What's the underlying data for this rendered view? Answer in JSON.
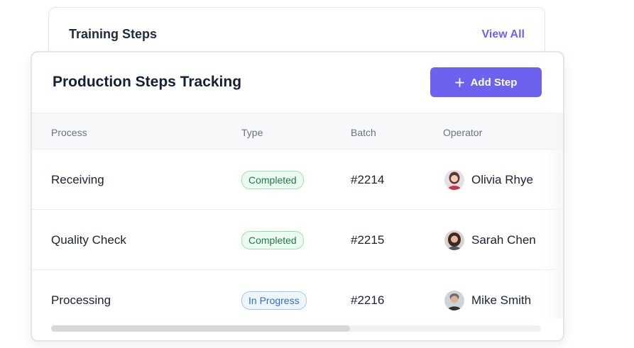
{
  "training": {
    "title": "Training Steps",
    "view_all": "View All"
  },
  "production": {
    "title": "Production Steps Tracking",
    "add_button": "Add Step",
    "columns": [
      "Process",
      "Type",
      "Batch",
      "Operator"
    ],
    "rows": [
      {
        "process": "Receiving",
        "type": "Completed",
        "batch": "#2214",
        "operator": "Olivia Rhye"
      },
      {
        "process": "Quality Check",
        "type": "Completed",
        "batch": "#2215",
        "operator": "Sarah Chen"
      },
      {
        "process": "Processing",
        "type": "In Progress",
        "batch": "#2216",
        "operator": "Mike Smith"
      }
    ],
    "horizontal_scroll_fraction": 0.61
  },
  "colors": {
    "accent": "#6d62ef",
    "link": "#6c63f0",
    "completed": "#1f7a45",
    "in_progress": "#2f6fc9"
  },
  "icons": [
    "plus-icon",
    "avatar"
  ]
}
